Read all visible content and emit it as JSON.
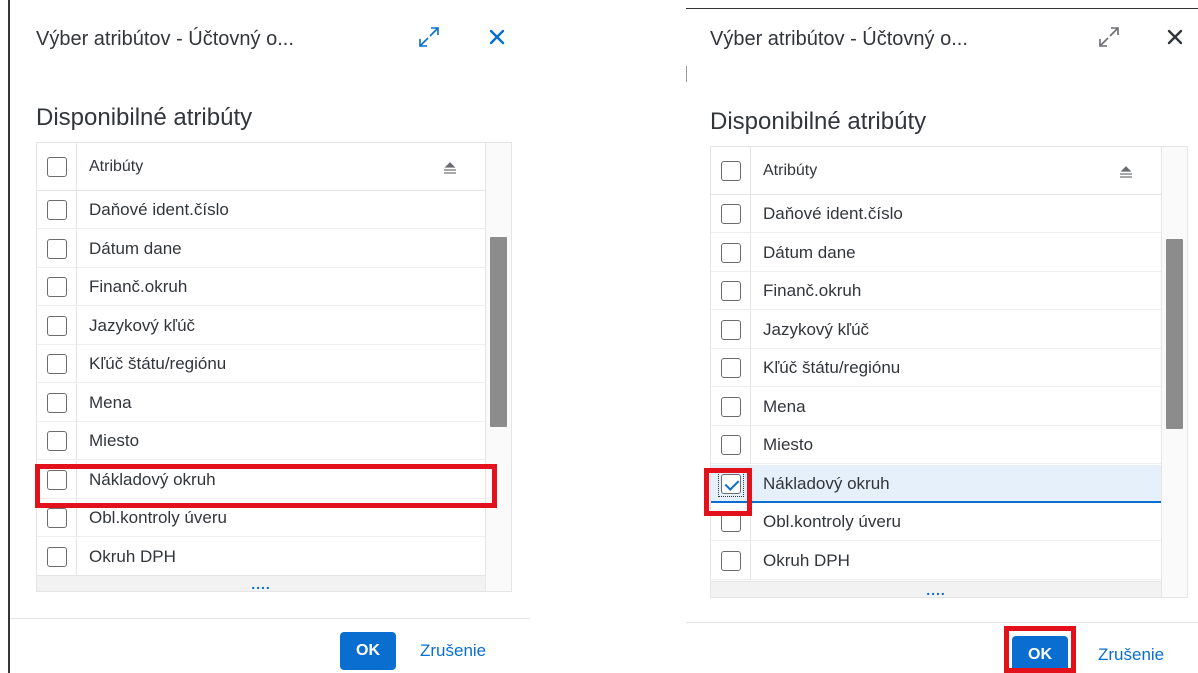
{
  "dialog_left": {
    "title": "Výber atribútov - Účtovný o...",
    "section_title": "Disponibilné atribúty",
    "column_header": "Atribúty",
    "rows": [
      {
        "label": "Daňové ident.číslo",
        "checked": false
      },
      {
        "label": "Dátum dane",
        "checked": false
      },
      {
        "label": "Finanč.okruh",
        "checked": false
      },
      {
        "label": "Jazykový kľúč",
        "checked": false
      },
      {
        "label": "Kľúč štátu/regiónu",
        "checked": false
      },
      {
        "label": "Mena",
        "checked": false
      },
      {
        "label": "Miesto",
        "checked": false
      },
      {
        "label": "Nákladový okruh",
        "checked": false
      },
      {
        "label": "Obl.kontroly úveru",
        "checked": false
      },
      {
        "label": "Okruh DPH",
        "checked": false
      }
    ],
    "more_indicator": "....",
    "ok_label": "OK",
    "cancel_label": "Zrušenie"
  },
  "dialog_right": {
    "title": "Výber atribútov - Účtovný o...",
    "section_title": "Disponibilné atribúty",
    "column_header": "Atribúty",
    "rows": [
      {
        "label": "Daňové ident.číslo",
        "checked": false
      },
      {
        "label": "Dátum dane",
        "checked": false
      },
      {
        "label": "Finanč.okruh",
        "checked": false
      },
      {
        "label": "Jazykový kľúč",
        "checked": false
      },
      {
        "label": "Kľúč štátu/regiónu",
        "checked": false
      },
      {
        "label": "Mena",
        "checked": false
      },
      {
        "label": "Miesto",
        "checked": false
      },
      {
        "label": "Nákladový okruh",
        "checked": true
      },
      {
        "label": "Obl.kontroly úveru",
        "checked": false
      },
      {
        "label": "Okruh DPH",
        "checked": false
      }
    ],
    "more_indicator": "....",
    "ok_label": "OK",
    "cancel_label": "Zrušenie"
  },
  "colors": {
    "accent": "#0a6ed1",
    "highlight": "#e3111b",
    "selected_row": "#e5f0fa",
    "text": "#32363a"
  },
  "icons": {
    "expand": "expand-icon",
    "close": "close-icon",
    "sort": "sort-icon"
  }
}
